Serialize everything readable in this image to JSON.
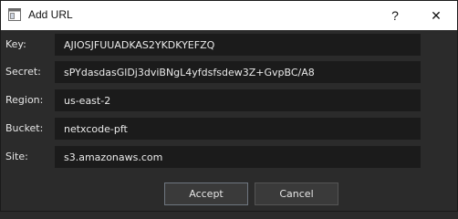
{
  "window": {
    "title": "Add URL",
    "help_label": "?",
    "close_label": "✕"
  },
  "fields": [
    {
      "label": "Key:",
      "value": "AJIOSJFUUADKAS2YKDKYEFZQ"
    },
    {
      "label": "Secret:",
      "value": "sPYdasdasGlDj3dviBNgL4yfdsfsdew3Z+GvpBC/A8"
    },
    {
      "label": "Region:",
      "value": "us-east-2"
    },
    {
      "label": "Bucket:",
      "value": "netxcode-pft"
    },
    {
      "label": "Site:",
      "value": "s3.amazonaws.com"
    }
  ],
  "buttons": {
    "accept": "Accept",
    "cancel": "Cancel"
  }
}
